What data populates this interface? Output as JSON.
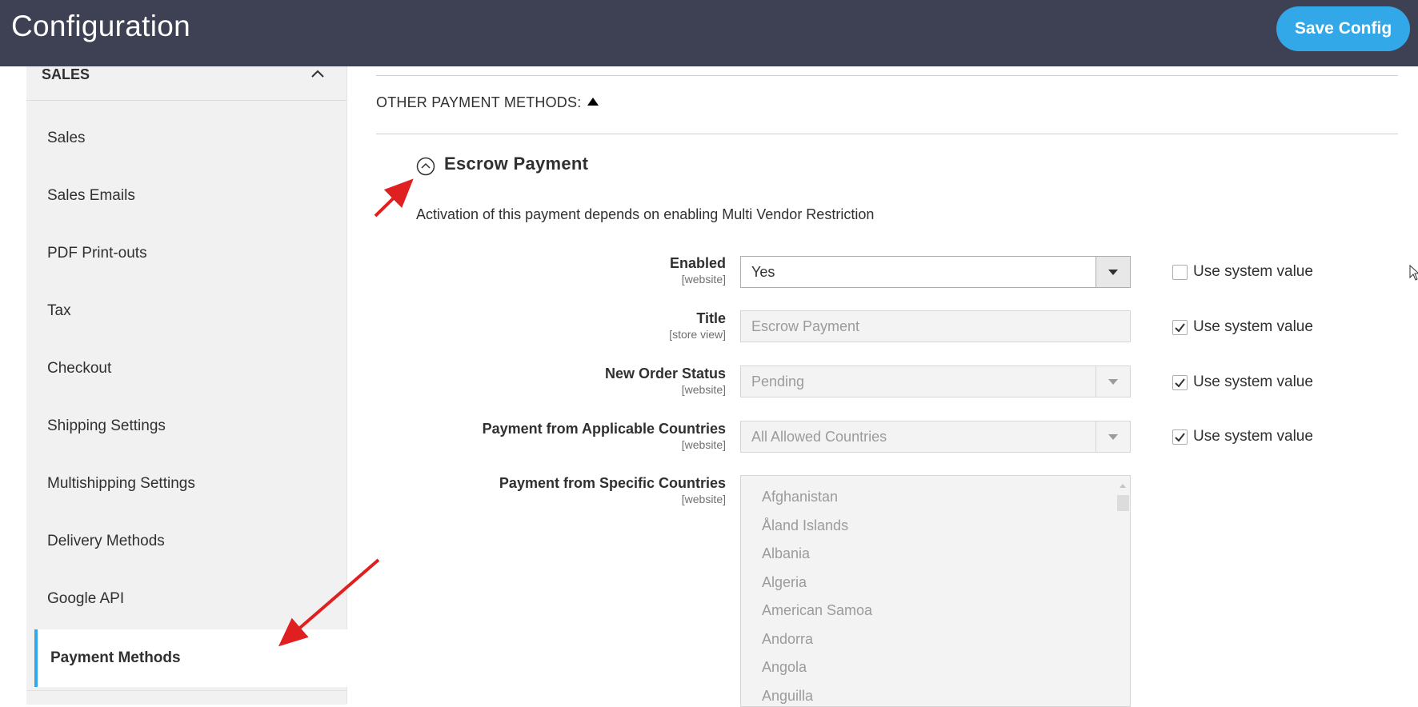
{
  "header": {
    "title": "Configuration",
    "save_label": "Save Config"
  },
  "sidebar": {
    "section_label": "SALES",
    "items": [
      {
        "label": "Sales"
      },
      {
        "label": "Sales Emails"
      },
      {
        "label": "PDF Print-outs"
      },
      {
        "label": "Tax"
      },
      {
        "label": "Checkout"
      },
      {
        "label": "Shipping Settings"
      },
      {
        "label": "Multishipping Settings"
      },
      {
        "label": "Delivery Methods"
      },
      {
        "label": "Google API"
      },
      {
        "label": "Payment Methods",
        "active": true
      }
    ]
  },
  "main": {
    "other_methods_label": "OTHER PAYMENT METHODS:",
    "section": {
      "title": "Escrow Payment",
      "note": "Activation of this payment depends on enabling Multi Vendor Restriction"
    },
    "fields": [
      {
        "label": "Enabled",
        "scope": "[website]",
        "value": "Yes",
        "use_system": false,
        "use_system_label": "Use system value"
      },
      {
        "label": "Title",
        "scope": "[store view]",
        "value": "Escrow Payment",
        "use_system": true,
        "use_system_label": "Use system value"
      },
      {
        "label": "New Order Status",
        "scope": "[website]",
        "value": "Pending",
        "use_system": true,
        "use_system_label": "Use system value"
      },
      {
        "label": "Payment from Applicable Countries",
        "scope": "[website]",
        "value": "All Allowed Countries",
        "use_system": true,
        "use_system_label": "Use system value"
      },
      {
        "label": "Payment from Specific Countries",
        "scope": "[website]"
      }
    ],
    "countries": [
      "Afghanistan",
      "Åland Islands",
      "Albania",
      "Algeria",
      "American Samoa",
      "Andorra",
      "Angola",
      "Anguilla"
    ]
  },
  "colors": {
    "header_bg": "#3d4153",
    "accent": "#33a8e8",
    "annotation_arrow": "#e02020"
  }
}
